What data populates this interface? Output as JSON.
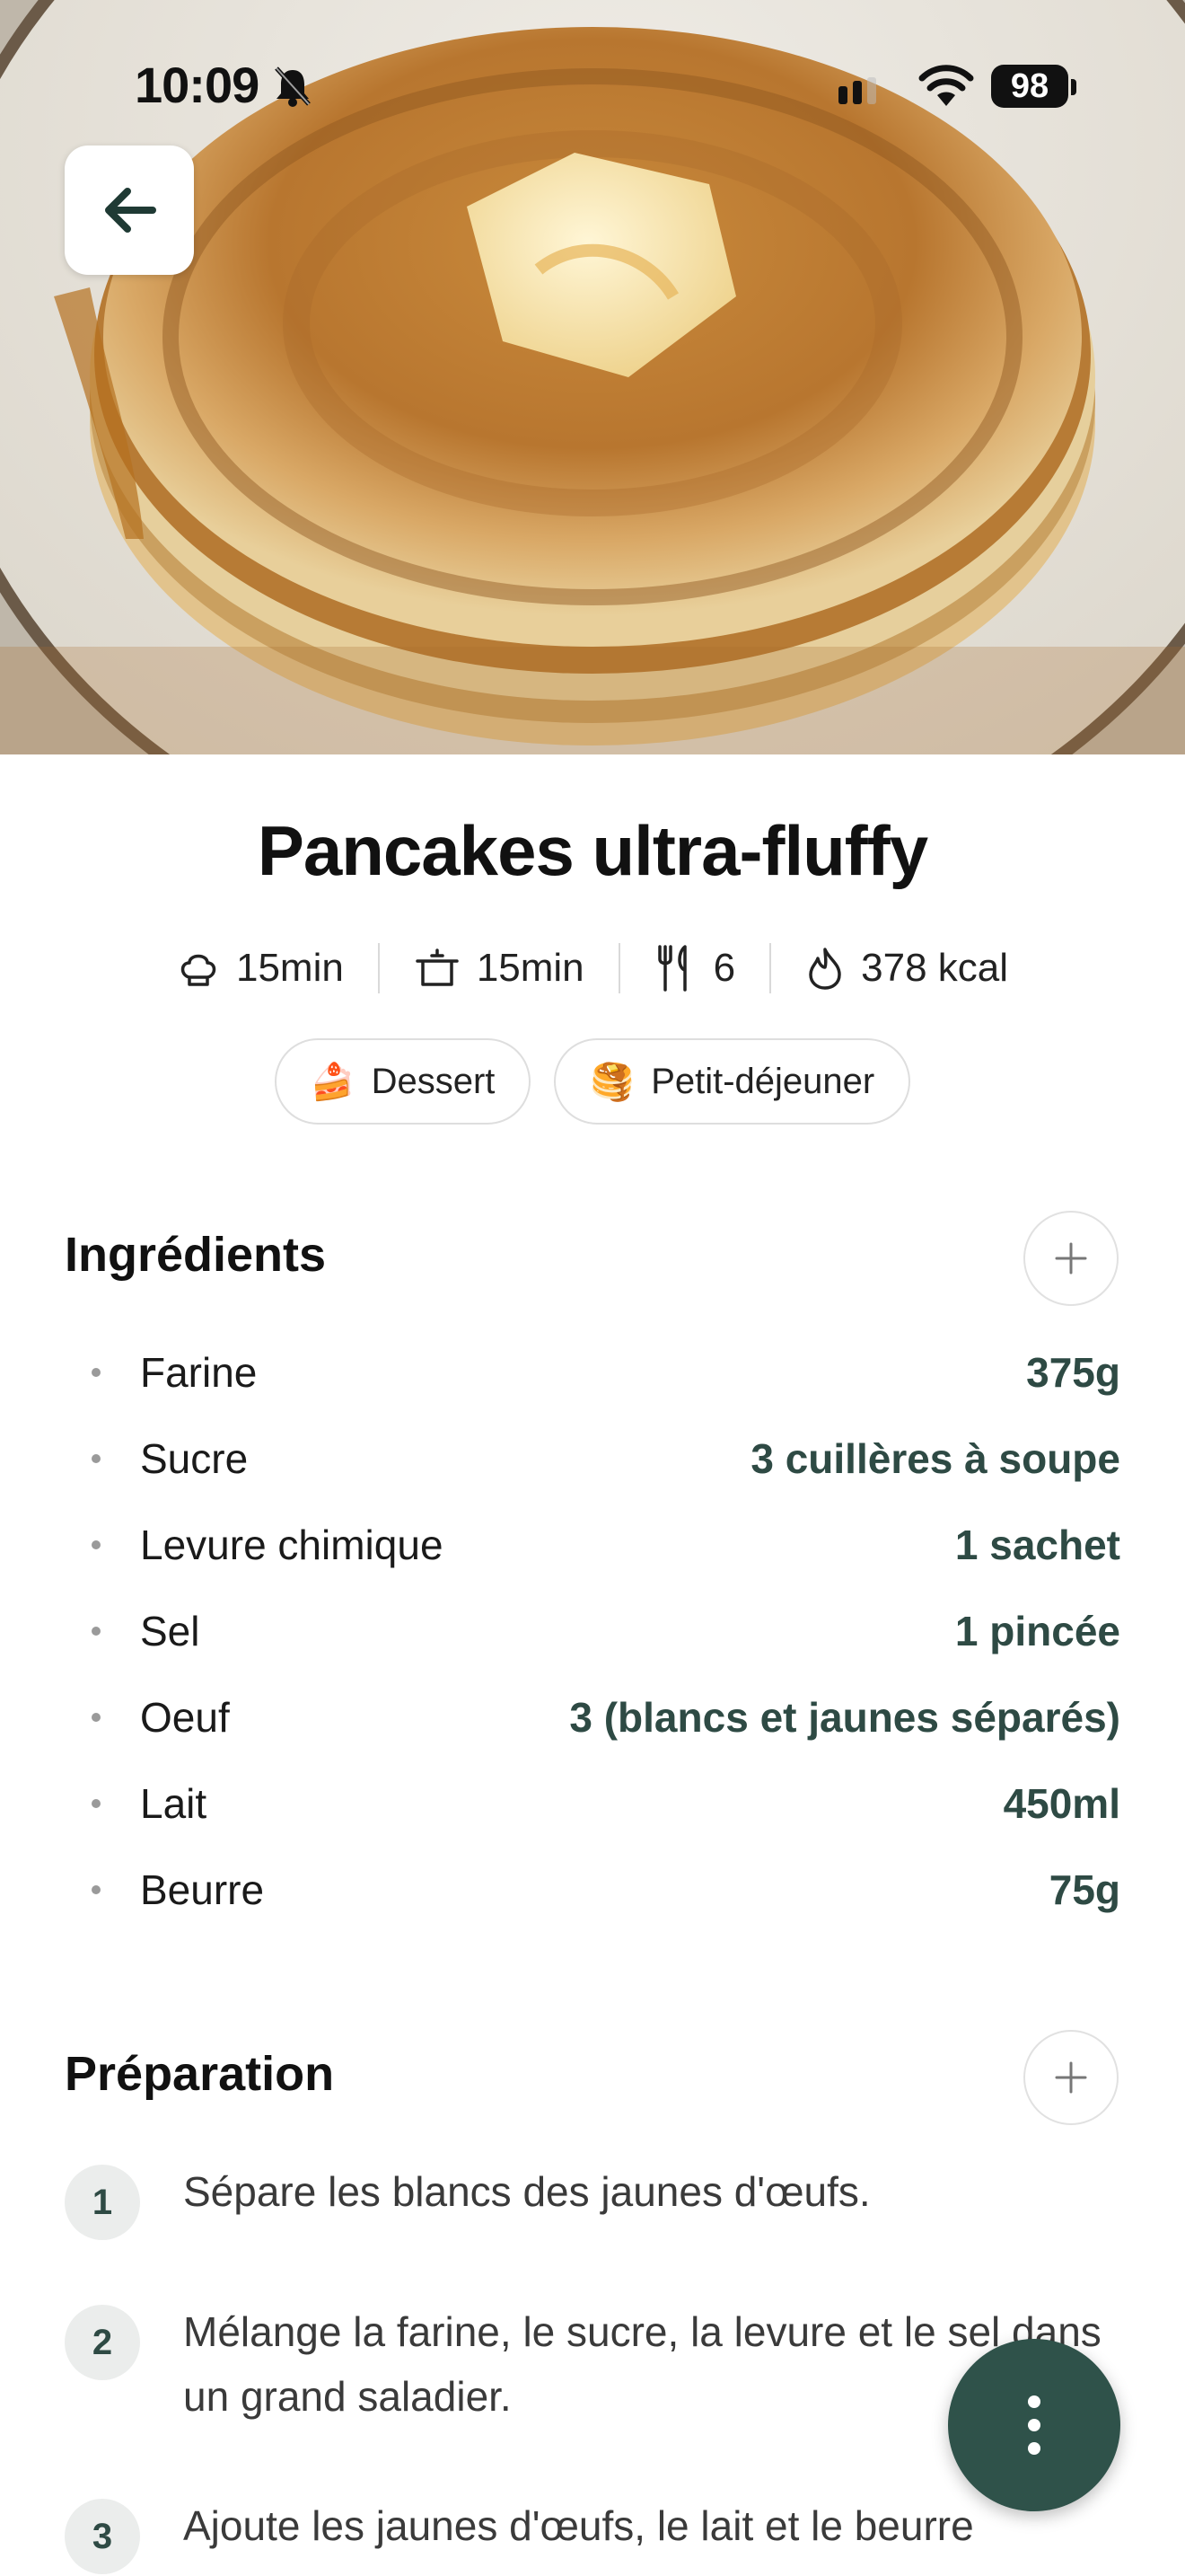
{
  "status_bar": {
    "time": "10:09",
    "battery": "98"
  },
  "recipe": {
    "title": "Pancakes ultra-fluffy",
    "meta": {
      "prep_time": "15min",
      "cook_time": "15min",
      "servings": "6",
      "calories": "378 kcal"
    },
    "tags": [
      {
        "emoji": "🍰",
        "label": "Dessert"
      },
      {
        "emoji": "🥞",
        "label": "Petit-déjeuner"
      }
    ]
  },
  "ingredients": {
    "title": "Ingrédients",
    "items": [
      {
        "name": "Farine",
        "qty": "375g"
      },
      {
        "name": "Sucre",
        "qty": "3 cuillères à soupe"
      },
      {
        "name": "Levure chimique",
        "qty": "1 sachet"
      },
      {
        "name": "Sel",
        "qty": "1 pincée"
      },
      {
        "name": "Oeuf",
        "qty": "3 (blancs et jaunes séparés)"
      },
      {
        "name": "Lait",
        "qty": "450ml"
      },
      {
        "name": "Beurre",
        "qty": "75g"
      }
    ]
  },
  "preparation": {
    "title": "Préparation",
    "steps": [
      {
        "num": "1",
        "text": "Sépare les blancs des jaunes d'œufs."
      },
      {
        "num": "2",
        "text": "Mélange la farine, le sucre, la levure et le sel dans un grand saladier."
      },
      {
        "num": "3",
        "text": "Ajoute les jaunes d'œufs, le lait et le beurre"
      }
    ]
  },
  "colors": {
    "accent": "#2f524a",
    "quantity": "#2e4a44"
  }
}
